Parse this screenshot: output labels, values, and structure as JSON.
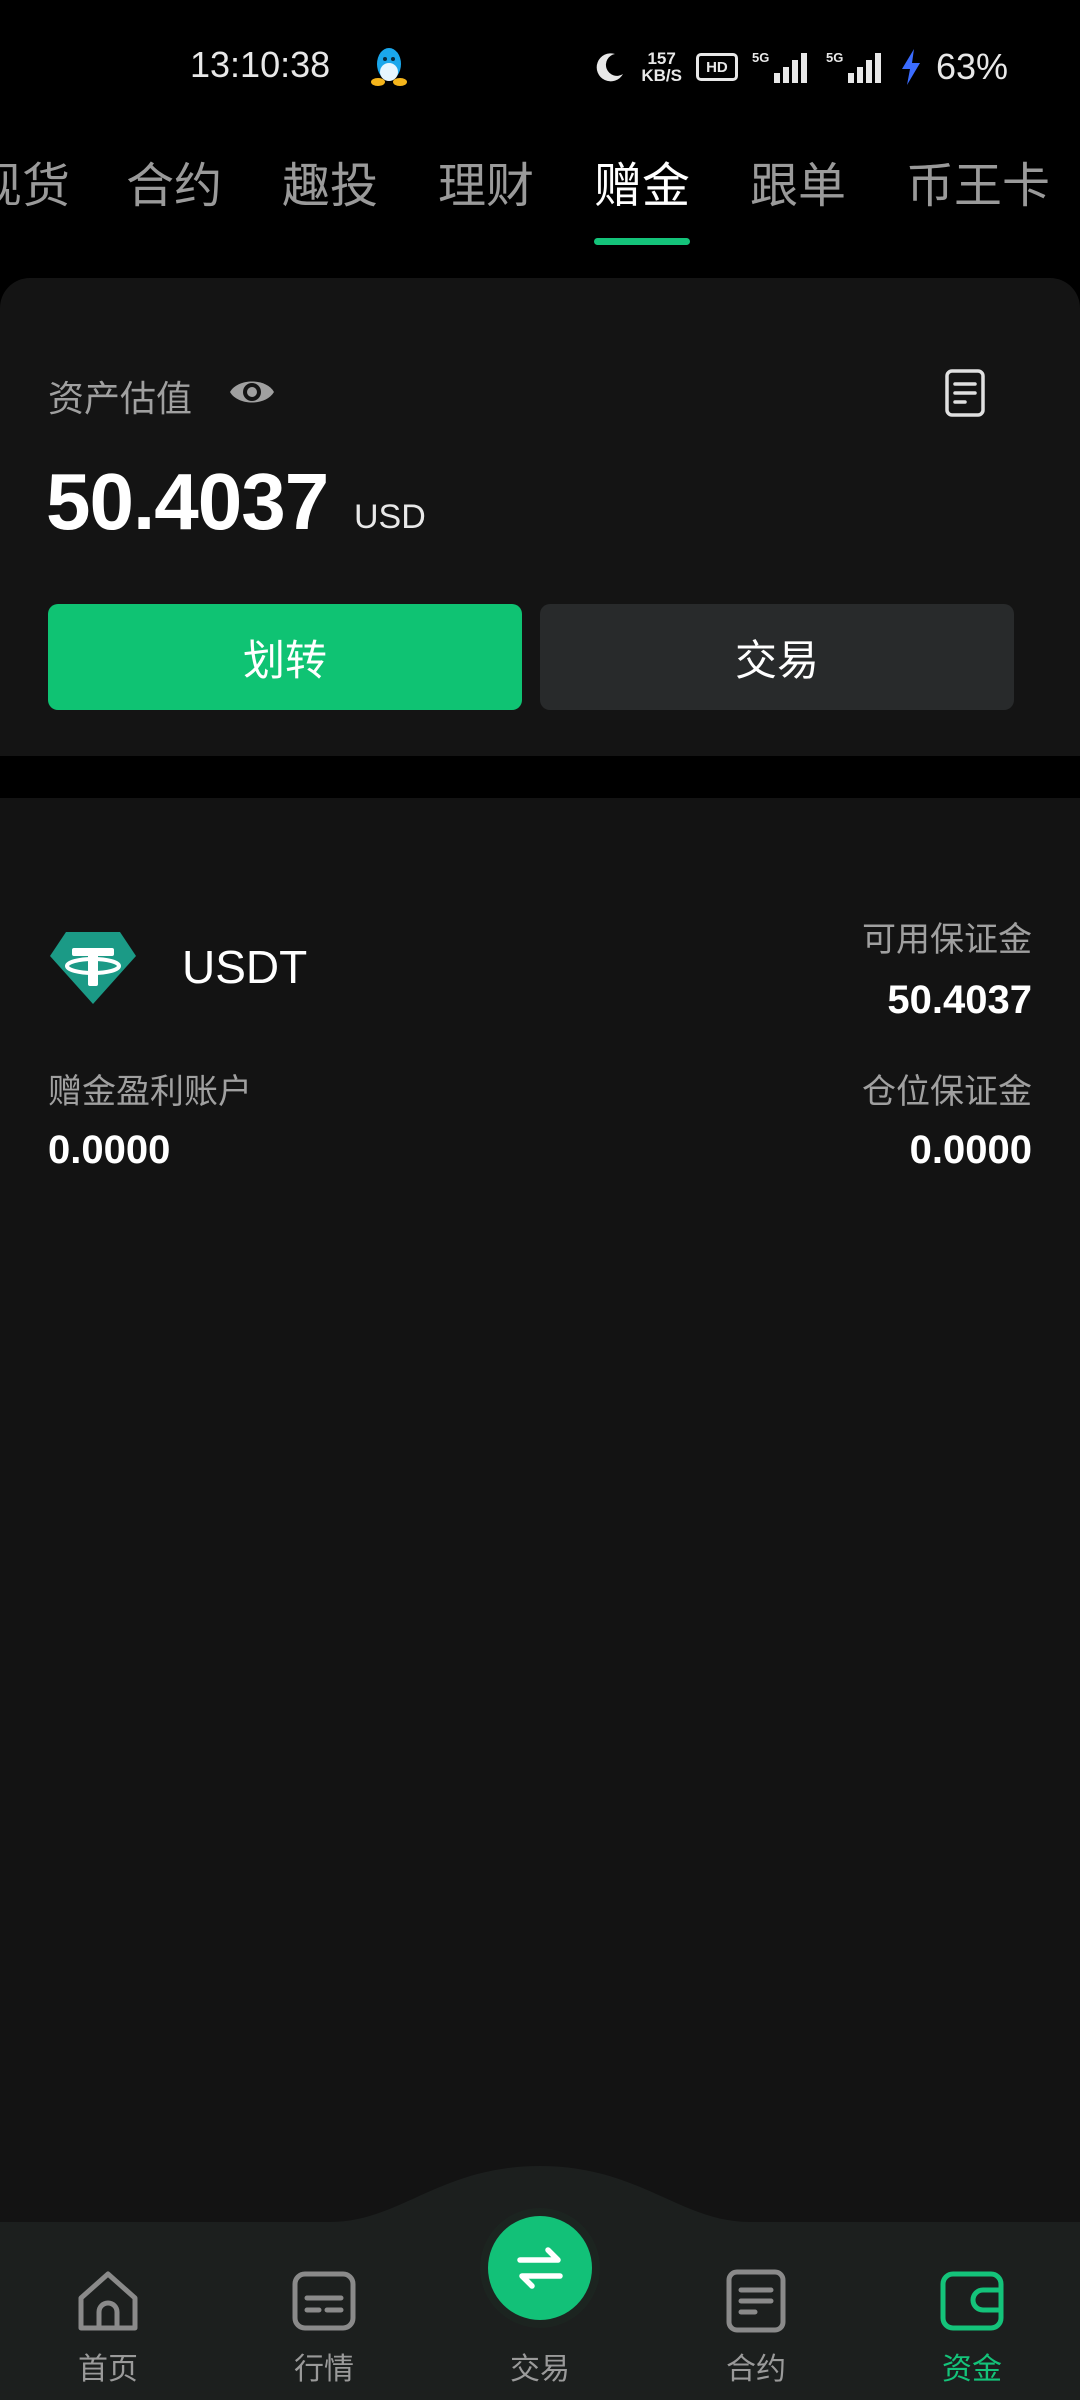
{
  "status_bar": {
    "time": "13:10:38",
    "speed_value": "157",
    "speed_unit": "KB/S",
    "hd": "HD",
    "signal_1": "5G",
    "signal_2": "5G",
    "battery": "63%"
  },
  "tabs": [
    {
      "label": "现货"
    },
    {
      "label": "合约"
    },
    {
      "label": "趣投"
    },
    {
      "label": "理财"
    },
    {
      "label": "赠金"
    },
    {
      "label": "跟单"
    },
    {
      "label": "币王卡"
    }
  ],
  "active_tab": "赠金",
  "asset": {
    "label": "资产估值",
    "value": "50.4037",
    "unit": "USD",
    "transfer_button": "划转",
    "trade_button": "交易"
  },
  "account": {
    "coin": "USDT",
    "available_margin_label": "可用保证金",
    "available_margin_value": "50.4037",
    "bonus_profit_label": "赠金盈利账户",
    "bonus_profit_value": "0.0000",
    "position_margin_label": "仓位保证金",
    "position_margin_value": "0.0000"
  },
  "bottom_nav": {
    "items": [
      {
        "label": "首页",
        "icon": "home-icon"
      },
      {
        "label": "行情",
        "icon": "market-icon"
      },
      {
        "label": "交易",
        "icon": "swap-icon"
      },
      {
        "label": "合约",
        "icon": "contract-icon"
      },
      {
        "label": "资金",
        "icon": "wallet-icon"
      }
    ],
    "active": "资金"
  },
  "colors": {
    "accent": "#14c37a",
    "background": "#131313",
    "card": "#141414",
    "secondary_button": "#282a2b",
    "usdt": "#26a17b"
  }
}
